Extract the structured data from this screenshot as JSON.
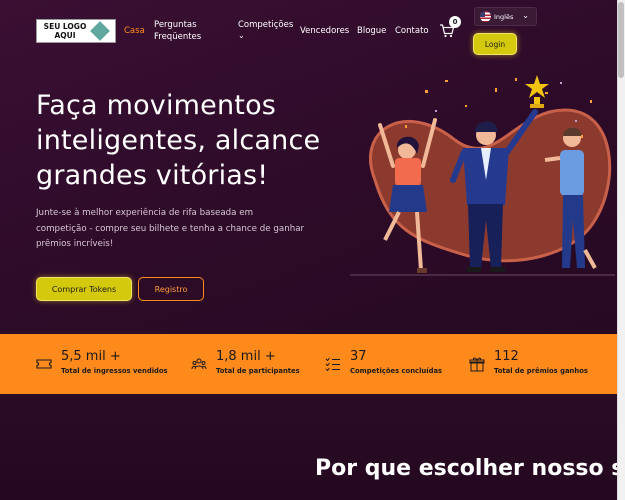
{
  "header": {
    "logo_line1": "SEU LOGO",
    "logo_line2": "AQUI",
    "nav": [
      {
        "label": "Casa",
        "active": true
      },
      {
        "label": "Perguntas Freqüentes",
        "active": false
      },
      {
        "label": "Competições",
        "active": false
      },
      {
        "label": "Vencedores",
        "active": false
      },
      {
        "label": "Blogue",
        "active": false
      },
      {
        "label": "Contato",
        "active": false
      }
    ],
    "cart_count": "0",
    "language": "Inglês",
    "login_label": "Login"
  },
  "hero": {
    "title": "Faça movimentos inteligentes, alcance grandes vitórias!",
    "subtitle": "Junte-se à melhor experiência de rifa baseada em competição - compre seu bilhete e tenha a chance de ganhar prêmios incríveis!",
    "primary_button": "Comprar Tokens",
    "secondary_button": "Registro"
  },
  "stats": [
    {
      "value": "5,5 mil +",
      "label": "Total de ingressos vendidos",
      "icon": "ticket-icon"
    },
    {
      "value": "1,8 mil +",
      "label": "Total de participantes",
      "icon": "participants-icon"
    },
    {
      "value": "37",
      "label": "Competições concluídas",
      "icon": "checklist-icon"
    },
    {
      "value": "112",
      "label": "Total de prêmios ganhos",
      "icon": "gift-icon"
    }
  ],
  "why": {
    "title": "Por que escolher nosso sorteio baseado"
  },
  "colors": {
    "background": "#2c0d27",
    "accent_orange": "#ff8a1c",
    "button_yellow": "#d4c90c"
  }
}
